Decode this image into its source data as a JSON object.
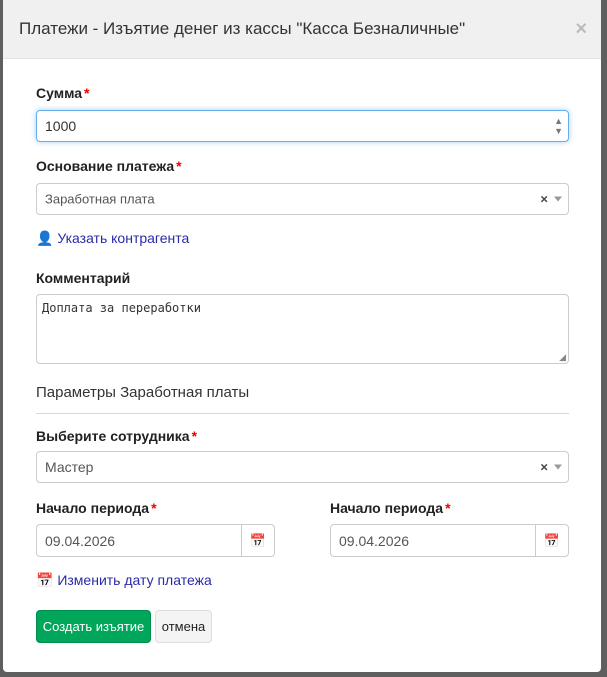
{
  "modal": {
    "title": "Платежи - Изъятие денег из кассы \"Касса Безналичные\"",
    "close": "×"
  },
  "amount": {
    "label": "Сумма",
    "required": "*",
    "value": "1000"
  },
  "basis": {
    "label": "Основание платежа",
    "required": "*",
    "value": "Заработная плата",
    "clear": "×"
  },
  "counterparty_link": "Указать контрагента",
  "comment": {
    "label": "Комментарий",
    "value": "Доплата за переработки"
  },
  "params_title": "Параметры Заработная платы",
  "employee": {
    "label": "Выберите сотрудника",
    "required": "*",
    "value": "Мастер",
    "clear": "×"
  },
  "period_start": {
    "label": "Начало периода",
    "required": "*",
    "value": "09.04.2026"
  },
  "period_end": {
    "label": "Начало периода",
    "required": "*",
    "value": "09.04.2026"
  },
  "change_date_link": "Изменить дату платежа",
  "buttons": {
    "submit": "Создать изъятие",
    "cancel": "отмена"
  },
  "colors": {
    "primary": "#00a65a",
    "link": "#2a2aa8"
  }
}
